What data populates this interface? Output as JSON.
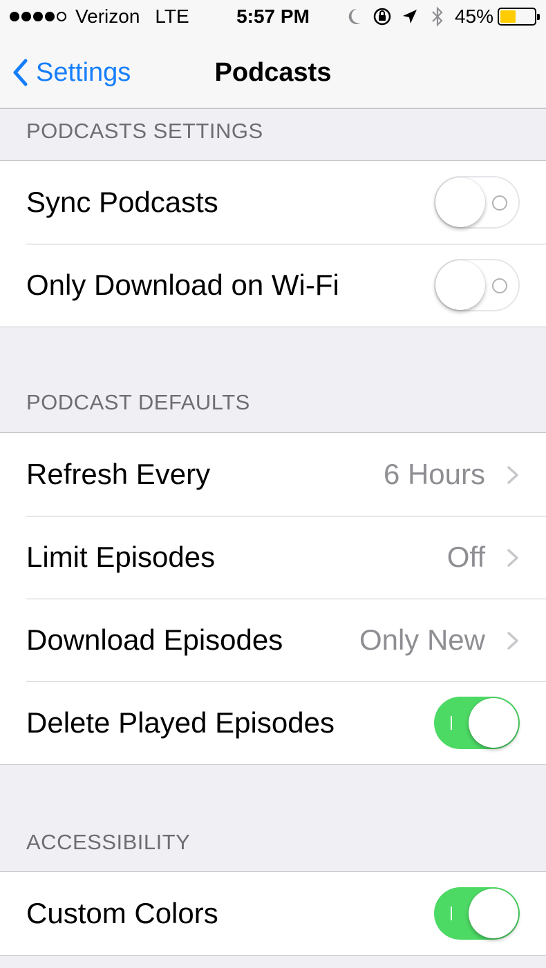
{
  "status_bar": {
    "carrier": "Verizon",
    "network": "LTE",
    "time": "5:57 PM",
    "battery_percent": "45%",
    "battery_level": 0.45,
    "battery_color": "#ffcc00",
    "icons": [
      "moon-icon",
      "orientation-lock-icon",
      "location-icon",
      "bluetooth-icon"
    ]
  },
  "nav": {
    "back_label": "Settings",
    "title": "Podcasts"
  },
  "sections": [
    {
      "header": "PODCASTS SETTINGS",
      "rows": [
        {
          "label": "Sync Podcasts",
          "type": "toggle",
          "on": false
        },
        {
          "label": "Only Download on Wi-Fi",
          "type": "toggle",
          "on": false
        }
      ]
    },
    {
      "header": "PODCAST DEFAULTS",
      "rows": [
        {
          "label": "Refresh Every",
          "type": "disclosure",
          "value": "6 Hours"
        },
        {
          "label": "Limit Episodes",
          "type": "disclosure",
          "value": "Off"
        },
        {
          "label": "Download Episodes",
          "type": "disclosure",
          "value": "Only New"
        },
        {
          "label": "Delete Played Episodes",
          "type": "toggle",
          "on": true
        }
      ]
    },
    {
      "header": "ACCESSIBILITY",
      "rows": [
        {
          "label": "Custom Colors",
          "type": "toggle",
          "on": true
        }
      ]
    }
  ],
  "colors": {
    "accent": "#157efb",
    "toggle_on": "#4cd964",
    "background": "#efeff4"
  }
}
